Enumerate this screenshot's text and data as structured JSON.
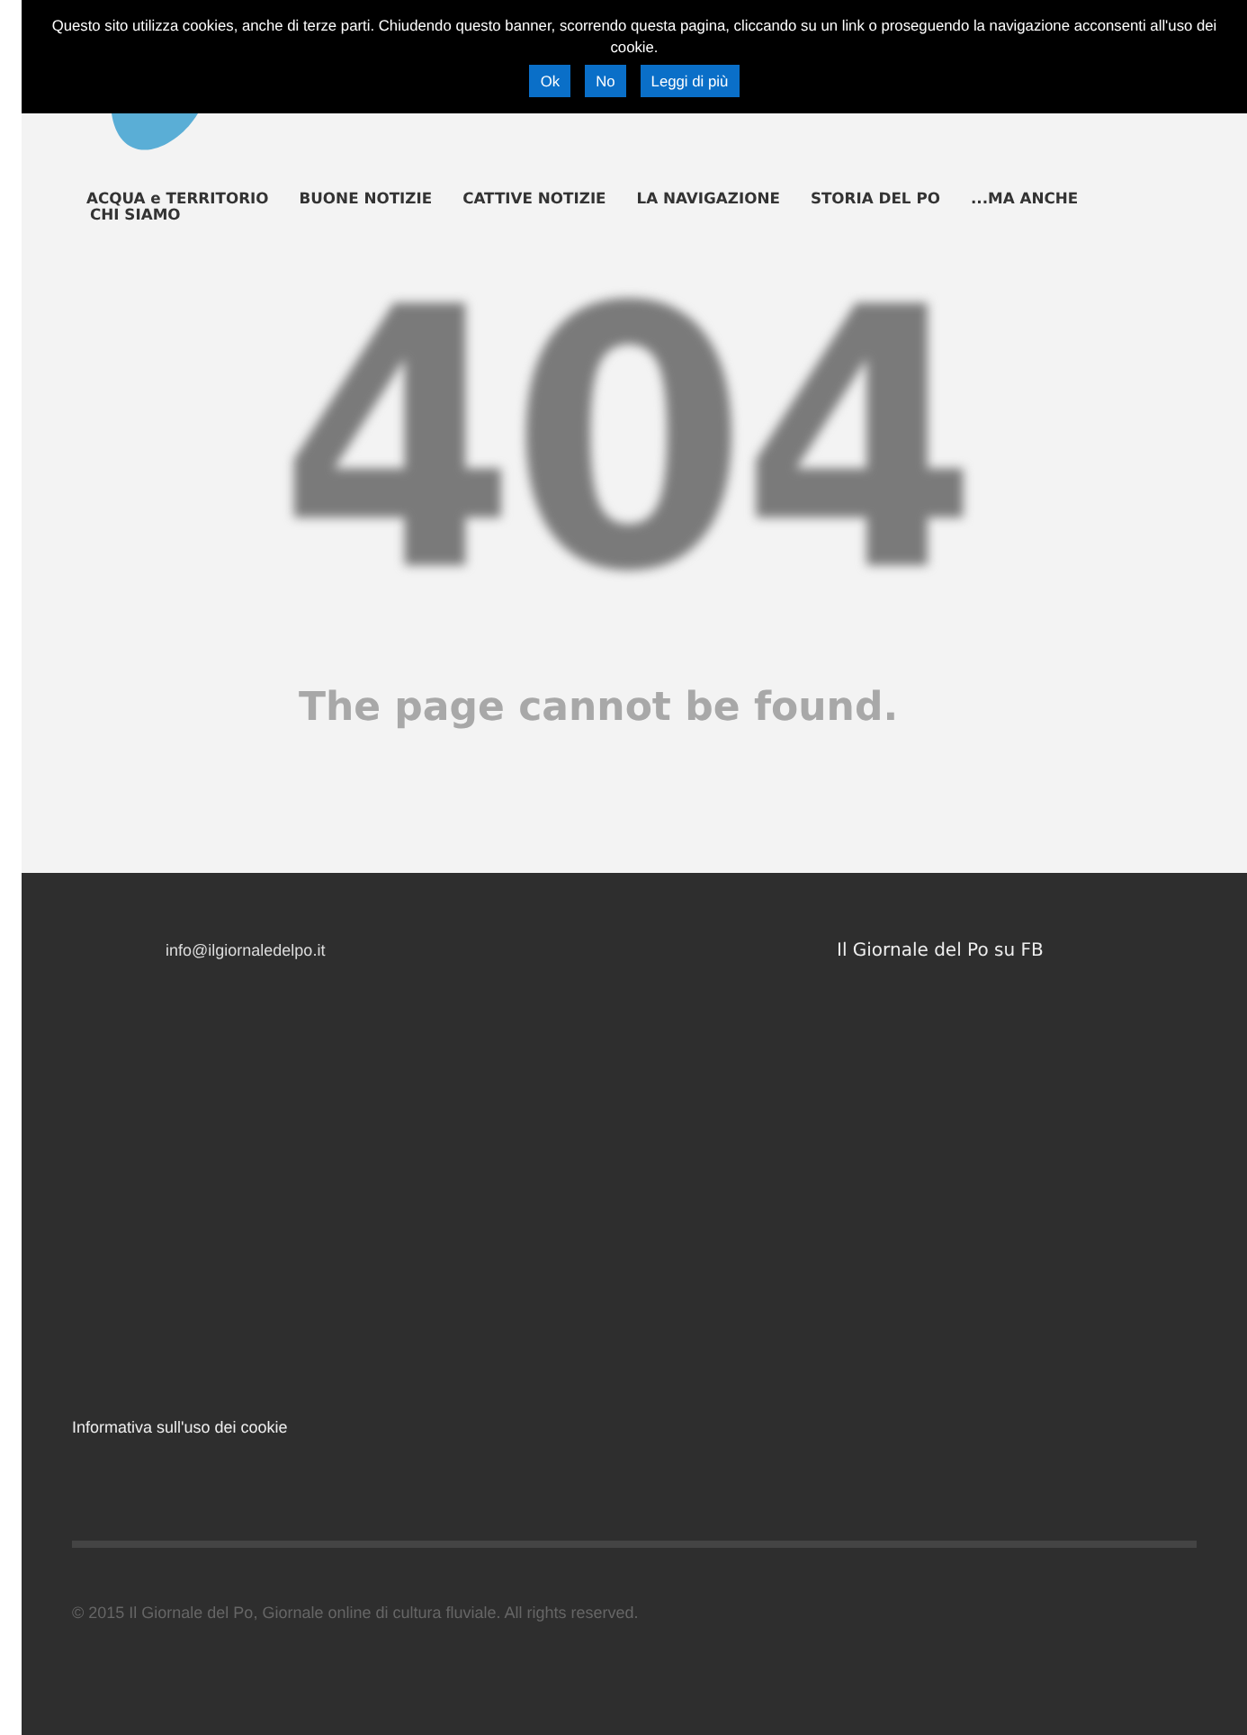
{
  "cookie_banner": {
    "message": "Questo sito utilizza cookies, anche di terze parti. Chiudendo questo banner, scorrendo questa pagina, cliccando su un link o proseguendo la navigazione acconsenti all'uso dei cookie.",
    "buttons": [
      "Ok",
      "No",
      "Leggi di più"
    ]
  },
  "nav": {
    "items": [
      "ACQUA e TERRITORIO",
      "BUONE NOTIZIE",
      "CATTIVE NOTIZIE",
      "LA NAVIGAZIONE",
      "STORIA DEL PO",
      "...MA ANCHE",
      "CHI SIAMO"
    ]
  },
  "error": {
    "code": "404",
    "message": "The page cannot be found."
  },
  "footer": {
    "email": "info@ilgiornaledelpo.it",
    "facebook_title": "Il Giornale del Po su FB",
    "cookie_link": "Informativa sull'uso dei cookie",
    "copyright": "© 2015 Il Giornale del Po, Giornale online di cultura fluviale. All rights reserved."
  }
}
